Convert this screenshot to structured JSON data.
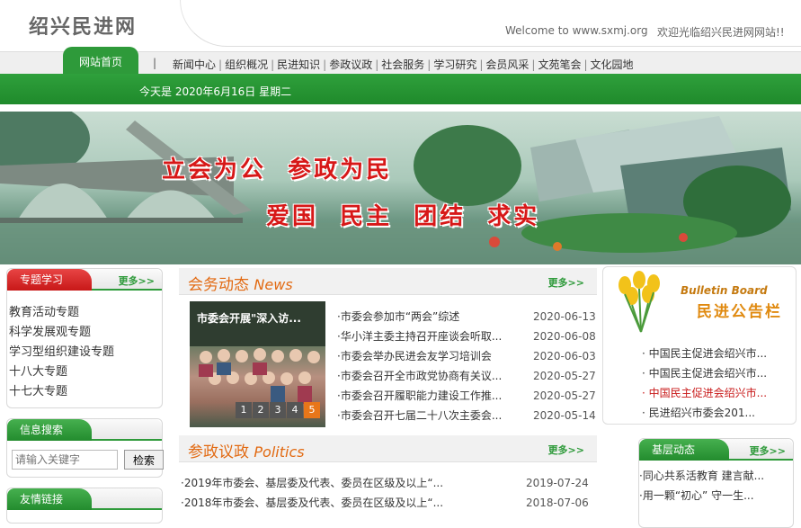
{
  "header": {
    "logo": "绍兴民进网",
    "welcome_en": "Welcome to www.sxmj.org",
    "welcome_cn": "欢迎光临绍兴民进网网站!!"
  },
  "nav": {
    "home": "网站首页",
    "separator": "|",
    "items": [
      "新闻中心",
      "组织概况",
      "民进知识",
      "参政议政",
      "社会服务",
      "学习研究",
      "会员风采",
      "文苑笔会",
      "文化园地"
    ]
  },
  "date_text": "今天是 2020年6月16日 星期二",
  "banner": {
    "slogan1": "立会为公  参政为民",
    "slogan2": "爱国  民主  团结  求实"
  },
  "topics": {
    "title": "专题学习",
    "more": "更多>>",
    "items": [
      "教育活动专题",
      "科学发展观专题",
      "学习型组织建设专题",
      "十八大专题",
      "十七大专题"
    ]
  },
  "search": {
    "title": "信息搜索",
    "placeholder": "请输入关键字",
    "button": "检索"
  },
  "links": {
    "title": "友情链接"
  },
  "news": {
    "title_cn": "会务动态",
    "title_en": "News",
    "more": "更多>>",
    "photo_caption": "市委会开展\"深入访...",
    "pager": [
      "1",
      "2",
      "3",
      "4",
      "5"
    ],
    "items": [
      {
        "title": "·市委会参加市“两会”综述",
        "date": "2020-06-13"
      },
      {
        "title": "·华小洋主委主持召开座谈会听取...",
        "date": "2020-06-08"
      },
      {
        "title": "·市委会举办民进会友学习培训会",
        "date": "2020-06-03"
      },
      {
        "title": "·市委会召开全市政党协商有关议...",
        "date": "2020-05-27"
      },
      {
        "title": "·市委会召开履职能力建设工作推...",
        "date": "2020-05-27"
      },
      {
        "title": "·市委会召开七届二十八次主委会...",
        "date": "2020-05-14"
      }
    ]
  },
  "politics": {
    "title_cn": "参政议政",
    "title_en": "Politics",
    "more": "更多>>",
    "items": [
      {
        "title": "·2019年市委会、基层委及代表、委员在区级及以上“...",
        "date": "2019-07-24"
      },
      {
        "title": "·2018年市委会、基层委及代表、委员在区级及以上“...",
        "date": "2018-07-06"
      }
    ]
  },
  "bulletin": {
    "title_en": "Bulletin Board",
    "title_cn": "民进公告栏",
    "items": [
      {
        "title": "· 中国民主促进会绍兴市...",
        "color": "#333333"
      },
      {
        "title": "· 中国民主促进会绍兴市...",
        "color": "#333333"
      },
      {
        "title": "· 中国民主促进会绍兴市...",
        "color": "#c81818"
      },
      {
        "title": "· 民进绍兴市委会201...",
        "color": "#333333"
      }
    ]
  },
  "basic": {
    "title": "基层动态",
    "more": "更多>>",
    "items": [
      "·同心共系活教育 建言献...",
      "·用一颗“初心” 守一生..."
    ]
  },
  "colors": {
    "accent_green": "#2e9a3a",
    "accent_red": "#d71818",
    "accent_orange": "#e26a12"
  }
}
